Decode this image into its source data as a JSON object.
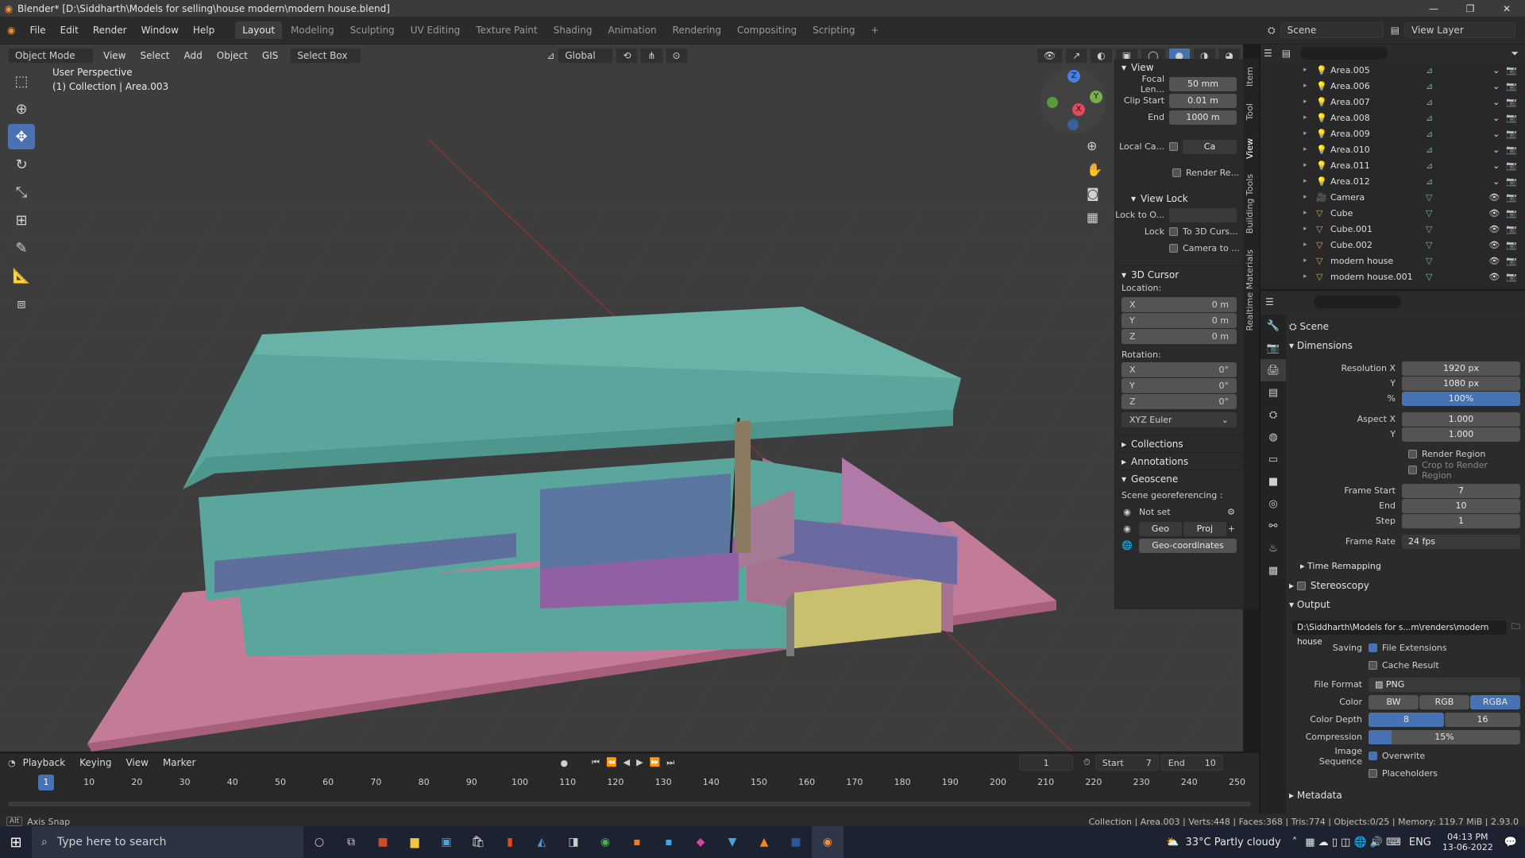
{
  "titlebar": {
    "title": "Blender* [D:\\Siddharth\\Models for selling\\house modern\\modern house.blend]",
    "minimize": "—",
    "restore": "❐",
    "close": "✕"
  },
  "menus": [
    "File",
    "Edit",
    "Render",
    "Window",
    "Help"
  ],
  "workspaces": [
    "Layout",
    "Modeling",
    "Sculpting",
    "UV Editing",
    "Texture Paint",
    "Shading",
    "Animation",
    "Rendering",
    "Compositing",
    "Scripting"
  ],
  "scene": {
    "label": "Scene",
    "view_layer": "View Layer"
  },
  "vp_header": {
    "mode": "Object Mode",
    "view": "View",
    "select": "Select",
    "add": "Add",
    "object": "Object",
    "gis": "GIS",
    "select_box": "Select Box",
    "orientation": "Global"
  },
  "overlay": {
    "perspective": "User Perspective",
    "collection": "(1) Collection | Area.003"
  },
  "gizmo": {
    "x": "X",
    "y": "Y",
    "z": "Z"
  },
  "npanel": {
    "view_title": "View",
    "focal_label": "Focal Len...",
    "focal_value": "50 mm",
    "clip_start_label": "Clip Start",
    "clip_start_value": "0.01 m",
    "end_label": "End",
    "end_value": "1000 m",
    "local_camera_label": "Local Ca...",
    "local_camera_value": "Ca",
    "render_region_label": "Render Re...",
    "view_lock_title": "View Lock",
    "lock_to_label": "Lock to O...",
    "lock_label": "Lock",
    "to_3d_cursor": "To 3D Curs...",
    "camera_to": "Camera to ...",
    "cursor_title": "3D Cursor",
    "location_label": "Location:",
    "loc_x": "0 m",
    "loc_y": "0 m",
    "loc_z": "0 m",
    "rotation_label": "Rotation:",
    "rot_x": "0°",
    "rot_y": "0°",
    "rot_z": "0°",
    "euler": "XYZ Euler",
    "collections": "Collections",
    "annotations": "Annotations",
    "geoscene": "Geoscene",
    "georef_label": "Scene georeferencing :",
    "not_set": "Not set",
    "geo": "Geo",
    "proj": "Proj",
    "geo_coords": "Geo-coordinates"
  },
  "side_tabs": [
    "Item",
    "Tool",
    "View",
    "Building Tools",
    "Realtime Materials"
  ],
  "outliner": {
    "rows": [
      {
        "name": "Area.005",
        "type": "light"
      },
      {
        "name": "Area.006",
        "type": "light"
      },
      {
        "name": "Area.007",
        "type": "light"
      },
      {
        "name": "Area.008",
        "type": "light"
      },
      {
        "name": "Area.009",
        "type": "light"
      },
      {
        "name": "Area.010",
        "type": "light"
      },
      {
        "name": "Area.011",
        "type": "light"
      },
      {
        "name": "Area.012",
        "type": "light"
      },
      {
        "name": "Camera",
        "type": "camera"
      },
      {
        "name": "Cube",
        "type": "mesh"
      },
      {
        "name": "Cube.001",
        "type": "mesh"
      },
      {
        "name": "Cube.002",
        "type": "mesh"
      },
      {
        "name": "modern house",
        "type": "mesh"
      },
      {
        "name": "modern house.001",
        "type": "mesh"
      }
    ]
  },
  "props": {
    "context": "Scene",
    "dimensions": "Dimensions",
    "res_x_label": "Resolution X",
    "res_x": "1920 px",
    "res_y_label": "Y",
    "res_y": "1080 px",
    "pct_label": "%",
    "pct": "100%",
    "aspect_x_label": "Aspect X",
    "aspect_x": "1.000",
    "aspect_y_label": "Y",
    "aspect_y": "1.000",
    "render_region": "Render Region",
    "crop_region": "Crop to Render Region",
    "frame_start_label": "Frame Start",
    "frame_start": "7",
    "frame_end_label": "End",
    "frame_end": "10",
    "frame_step_label": "Step",
    "frame_step": "1",
    "frame_rate_label": "Frame Rate",
    "frame_rate": "24 fps",
    "time_remapping": "Time Remapping",
    "stereoscopy": "Stereoscopy",
    "output": "Output",
    "output_path": "D:\\Siddharth\\Models for s...m\\renders\\modern house",
    "saving_label": "Saving",
    "file_ext": "File Extensions",
    "cache_result": "Cache Result",
    "file_format_label": "File Format",
    "file_format": "PNG",
    "color_label": "Color",
    "color_bw": "BW",
    "color_rgb": "RGB",
    "color_rgba": "RGBA",
    "depth_label": "Color Depth",
    "depth_8": "8",
    "depth_16": "16",
    "compression_label": "Compression",
    "compression": "15%",
    "compression_fill": 0.15,
    "img_seq_label": "Image Sequence",
    "overwrite": "Overwrite",
    "placeholders": "Placeholders",
    "metadata": "Metadata"
  },
  "timeline": {
    "playback": "Playback",
    "keying": "Keying",
    "view": "View",
    "marker": "Marker",
    "current_frame": "1",
    "start_label": "Start",
    "start": "7",
    "end_label": "End",
    "end": "10",
    "ticks": [
      "1",
      "10",
      "20",
      "30",
      "40",
      "50",
      "60",
      "70",
      "80",
      "90",
      "100",
      "110",
      "120",
      "130",
      "140",
      "150",
      "160",
      "170",
      "180",
      "190",
      "200",
      "210",
      "220",
      "230",
      "240",
      "250"
    ]
  },
  "status": {
    "left": "Axis Snap",
    "right": "Collection | Area.003 | Verts:448 | Faces:368 | Tris:774 | Objects:0/25 | Memory: 119.7 MiB | 2.93.0"
  },
  "taskbar": {
    "search": "Type here to search",
    "weather": "33°C  Partly cloudy",
    "lang": "ENG",
    "time": "04:13 PM",
    "date": "13-06-2022"
  }
}
